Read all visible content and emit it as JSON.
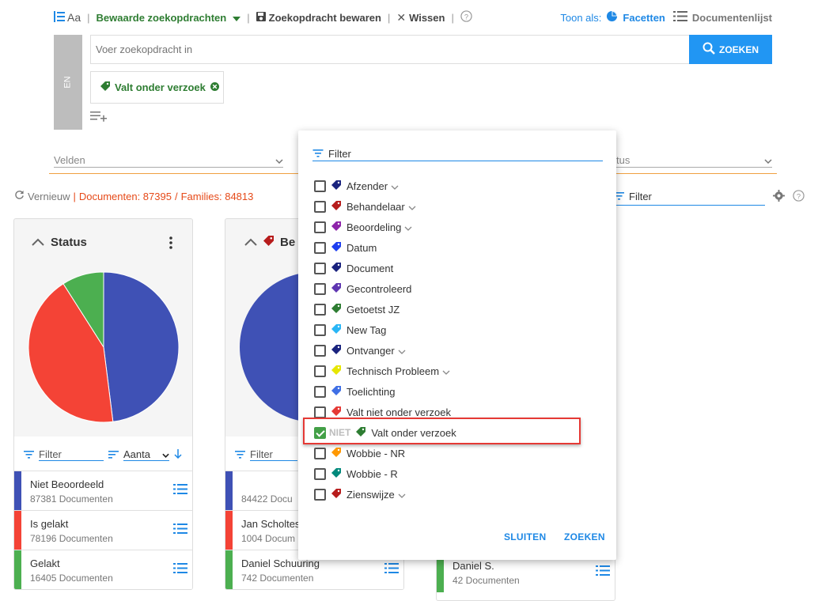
{
  "toolbar": {
    "font_label": "Aa",
    "saved_searches": "Bewaarde zoekopdrachten",
    "save_search": "Zoekopdracht bewaren",
    "clear": "Wissen",
    "show_as": "Toon als:",
    "facets": "Facetten",
    "doc_list": "Documentenlijst"
  },
  "search": {
    "lang": "EN",
    "placeholder": "Voer zoekopdracht in",
    "button": "ZOEKEN",
    "chip": "Valt onder verzoek"
  },
  "fields": {
    "left": "Velden",
    "right": "tus"
  },
  "status_line": {
    "refresh": "Vernieuw",
    "documents": "Documenten: 87395",
    "families": "Families: 84813"
  },
  "right_filter": "Filter",
  "card1": {
    "title": "Status",
    "filter": "Filter",
    "sort": "Aanta",
    "pie": [
      {
        "label": "Niet Beoordeeld",
        "value": 87381,
        "color": "#3f51b5"
      },
      {
        "label": "Is gelakt",
        "value": 78196,
        "color": "#f44336"
      },
      {
        "label": "Gelakt",
        "value": 16405,
        "color": "#4caf50"
      }
    ],
    "rows": [
      {
        "name": "Niet Beoordeeld",
        "count": "87381 Documenten",
        "color": "#3f51b5"
      },
      {
        "name": "Is gelakt",
        "count": "78196 Documenten",
        "color": "#f44336"
      },
      {
        "name": "Gelakt",
        "count": "16405 Documenten",
        "color": "#4caf50"
      }
    ]
  },
  "card2": {
    "title": "Be",
    "filter": "Filter",
    "rows": [
      {
        "name": "",
        "count": "84422 Docu",
        "color": "#3f51b5"
      },
      {
        "name": "Jan Scholtes",
        "count": "1004 Docum",
        "color": "#f44336"
      },
      {
        "name": "Daniel Schuuring",
        "count": "742 Documenten",
        "color": "#4caf50"
      }
    ]
  },
  "card3": {
    "rows": [
      {
        "name": "Daniel S.",
        "count": "42 Documenten",
        "color": "#4caf50"
      }
    ]
  },
  "panel": {
    "filter": "Filter",
    "options": [
      {
        "label": "Afzender",
        "color": "#1a237e",
        "expand": true,
        "checked": false
      },
      {
        "label": "Behandelaar",
        "color": "#b71c1c",
        "expand": true,
        "checked": false
      },
      {
        "label": "Beoordeling",
        "color": "#8e24aa",
        "expand": true,
        "checked": false
      },
      {
        "label": "Datum",
        "color": "#1e3ff0",
        "expand": false,
        "checked": false
      },
      {
        "label": "Document",
        "color": "#1a237e",
        "expand": false,
        "checked": false
      },
      {
        "label": "Gecontroleerd",
        "color": "#5e35b1",
        "expand": false,
        "checked": false
      },
      {
        "label": "Getoetst JZ",
        "color": "#2e7d32",
        "expand": false,
        "checked": false
      },
      {
        "label": "New Tag",
        "color": "#29b6f6",
        "expand": false,
        "checked": false
      },
      {
        "label": "Ontvanger",
        "color": "#1a237e",
        "expand": true,
        "checked": false
      },
      {
        "label": "Technisch Probleem",
        "color": "#e6e600",
        "expand": true,
        "checked": false
      },
      {
        "label": "Toelichting",
        "color": "#3f6fe5",
        "expand": false,
        "checked": false
      },
      {
        "label": "Valt niet onder verzoek",
        "color": "#e53935",
        "expand": false,
        "checked": false
      },
      {
        "label": "Valt onder verzoek",
        "color": "#2e7d32",
        "expand": false,
        "checked": true,
        "prefix": "NIET"
      },
      {
        "label": "Wobbie - NR",
        "color": "#ff9800",
        "expand": false,
        "checked": false
      },
      {
        "label": "Wobbie - R",
        "color": "#00897b",
        "expand": false,
        "checked": false
      },
      {
        "label": "Zienswijze",
        "color": "#b71c1c",
        "expand": true,
        "checked": false
      }
    ],
    "close": "SLUITEN",
    "search": "ZOEKEN"
  }
}
